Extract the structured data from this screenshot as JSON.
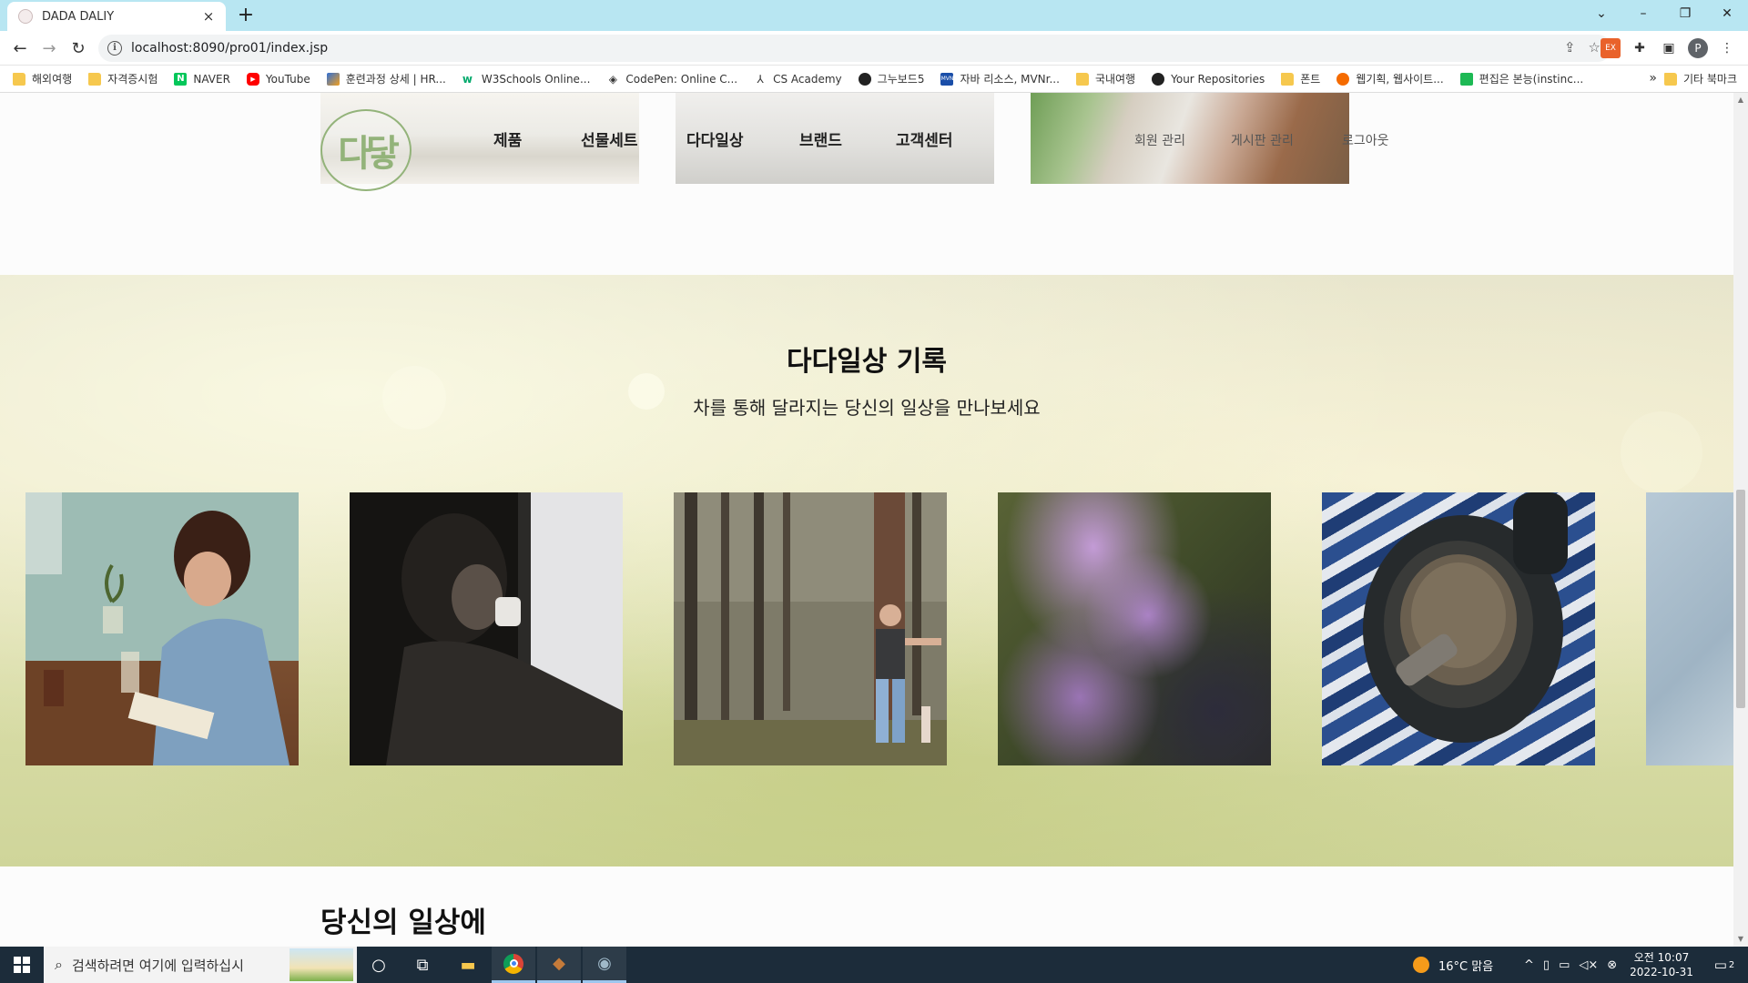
{
  "browser": {
    "tab_title": "DADA DALIY",
    "tab_close": "×",
    "new_tab": "+",
    "url": "localhost:8090/pro01/index.jsp",
    "win_controls": [
      "⌄",
      "–",
      "❐",
      "✕"
    ],
    "nav": {
      "back": "←",
      "forward": "→",
      "reload": "↻"
    }
  },
  "bookmarks": {
    "items": [
      {
        "label": "해외여행",
        "icon": "folder-icon"
      },
      {
        "label": "자격증시험",
        "icon": "folder-icon"
      },
      {
        "label": "NAVER",
        "icon": "naver-icon"
      },
      {
        "label": "YouTube",
        "icon": "youtube-icon"
      },
      {
        "label": "훈련과정 상세 | HR...",
        "icon": "hrd-icon"
      },
      {
        "label": "W3Schools Online...",
        "icon": "w3schools-icon"
      },
      {
        "label": "CodePen: Online C...",
        "icon": "codepen-icon"
      },
      {
        "label": "CS Academy",
        "icon": "csacademy-icon"
      },
      {
        "label": "그누보드5",
        "icon": "gnuboard-icon"
      },
      {
        "label": "자바 리소스, MVNr...",
        "icon": "mvn-icon"
      },
      {
        "label": "국내여행",
        "icon": "folder-icon"
      },
      {
        "label": "Your Repositories",
        "icon": "github-icon"
      },
      {
        "label": "폰트",
        "icon": "folder-icon"
      },
      {
        "label": "웹기획, 웹사이트...",
        "icon": "opera-icon"
      },
      {
        "label": "편집은 본능(instinc...",
        "icon": "bookmark-green-icon"
      }
    ],
    "more": "»",
    "other": "기타 북마크"
  },
  "site": {
    "menu": [
      "제품",
      "선물세트",
      "다다일상",
      "브랜드",
      "고객센터"
    ],
    "util": [
      "회원 관리",
      "게시판 관리",
      "로그아웃"
    ],
    "logo_text": "다닿"
  },
  "story": {
    "title": "다다일상 기록",
    "subtitle": "차를 통해 달라지는 당신의 일상을 만나보세요",
    "photos": [
      "woman-reading-cafe-photo",
      "woman-drinking-dark-photo",
      "man-forest-photo",
      "purple-flower-blur-photo",
      "tea-cup-striped-cloth-photo",
      "denim-fabric-photo"
    ]
  },
  "next_section": {
    "title": "당신의 일상에"
  },
  "taskbar": {
    "search_placeholder": "검색하려면 여기에 입력하십시",
    "weather": "16°C  맑음",
    "time": "오전 10:07",
    "date": "2022-10-31",
    "notifications": "2"
  },
  "colors": {
    "tab_bar": "#b8e6f2",
    "taskbar": "#1c2c3a",
    "logo_green": "#93b37a"
  }
}
